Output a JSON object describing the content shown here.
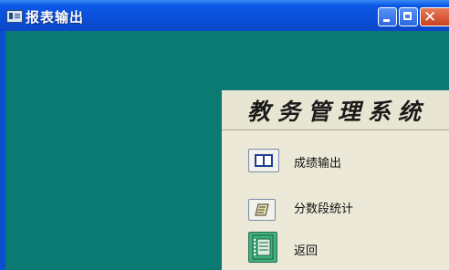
{
  "window": {
    "title": "报表输出",
    "controls": [
      "minimize",
      "maximize",
      "close"
    ]
  },
  "panel": {
    "title": "教务管理系统",
    "items": [
      {
        "label": "成绩输出",
        "icon": "book-icon"
      },
      {
        "label": "分数段统计",
        "icon": "note-icon"
      },
      {
        "label": "返回",
        "icon": "notebook-icon"
      }
    ]
  },
  "colors": {
    "titlebar": "#0a4fd8",
    "client_background": "#0b7a73",
    "panel_background": "#ece9d8"
  }
}
